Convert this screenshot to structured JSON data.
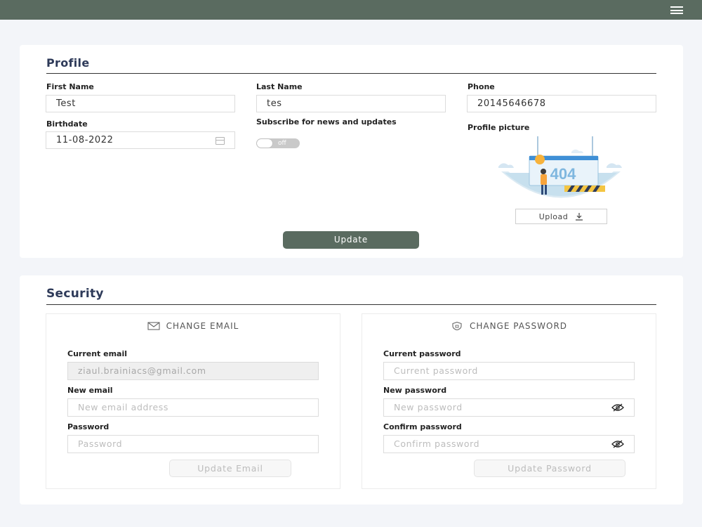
{
  "colors": {
    "topbar": "#5a6b60",
    "primary_button": "#5a6b60",
    "title": "#2e3a59"
  },
  "topbar": {
    "menu_icon": "hamburger-icon"
  },
  "profile": {
    "title": "Profile",
    "first_name": {
      "label": "First Name",
      "value": "Test"
    },
    "last_name": {
      "label": "Last Name",
      "value": "tes"
    },
    "phone": {
      "label": "Phone",
      "value": "20145646678"
    },
    "birthdate": {
      "label": "Birthdate",
      "value": "11-08-2022",
      "icon": "calendar-icon"
    },
    "subscribe": {
      "label": "Subscribe for news and updates",
      "state": "off"
    },
    "picture": {
      "label": "Profile picture",
      "image_text": "404",
      "upload_label": "Upload",
      "upload_icon": "download-icon"
    },
    "update_label": "Update"
  },
  "security": {
    "title": "Security",
    "change_email": {
      "heading": "CHANGE EMAIL",
      "icon": "envelope-icon",
      "current_email": {
        "label": "Current email",
        "value": "ziaul.brainiacs@gmail.com"
      },
      "new_email": {
        "label": "New email",
        "placeholder": "New email address"
      },
      "password": {
        "label": "Password",
        "placeholder": "Password"
      },
      "button_label": "Update Email"
    },
    "change_password": {
      "heading": "CHANGE PASSWORD",
      "icon": "shield-lock-icon",
      "current_password": {
        "label": "Current password",
        "placeholder": "Current password"
      },
      "new_password": {
        "label": "New password",
        "placeholder": "New password",
        "icon": "eye-slash-icon"
      },
      "confirm_password": {
        "label": "Confirm password",
        "placeholder": "Confirm password",
        "icon": "eye-slash-icon"
      },
      "button_label": "Update Password"
    }
  }
}
